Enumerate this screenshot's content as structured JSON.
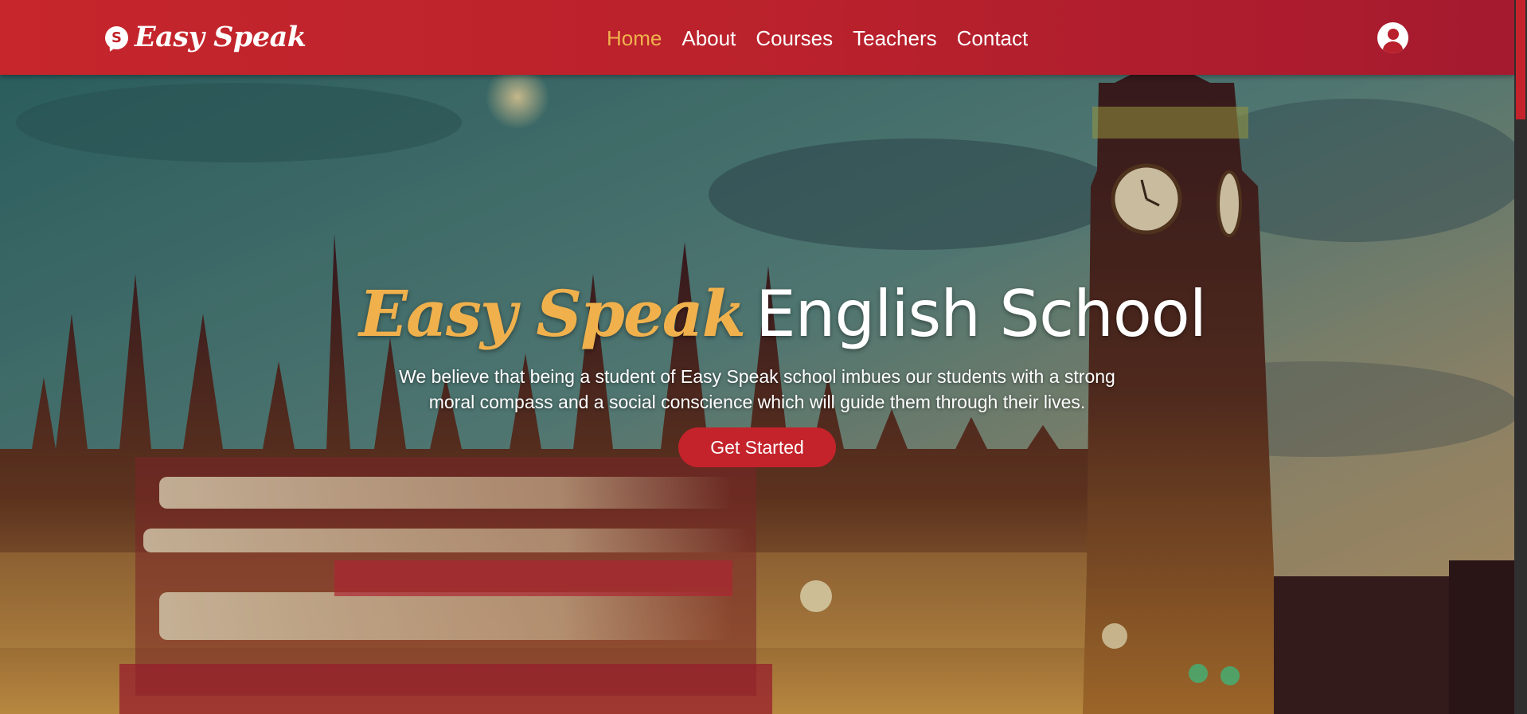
{
  "header": {
    "brand": {
      "icon_letter": "S",
      "name": "Easy Speak"
    },
    "nav": [
      {
        "label": "Home",
        "active": true
      },
      {
        "label": "About",
        "active": false
      },
      {
        "label": "Courses",
        "active": false
      },
      {
        "label": "Teachers",
        "active": false
      },
      {
        "label": "Contact",
        "active": false
      }
    ],
    "account_icon": "user-circle-icon"
  },
  "hero": {
    "title_brand": "Easy Speak",
    "title_rest": "English School",
    "description": "We believe that being a student of Easy Speak school imbues our students with a strong moral compass and a social conscience which will guide them through their lives.",
    "cta_label": "Get Started",
    "background": "london-westminster-big-ben-photo"
  },
  "colors": {
    "primary_red": "#c4232b",
    "accent_gold": "#f0b14d",
    "text_white": "#ffffff"
  }
}
